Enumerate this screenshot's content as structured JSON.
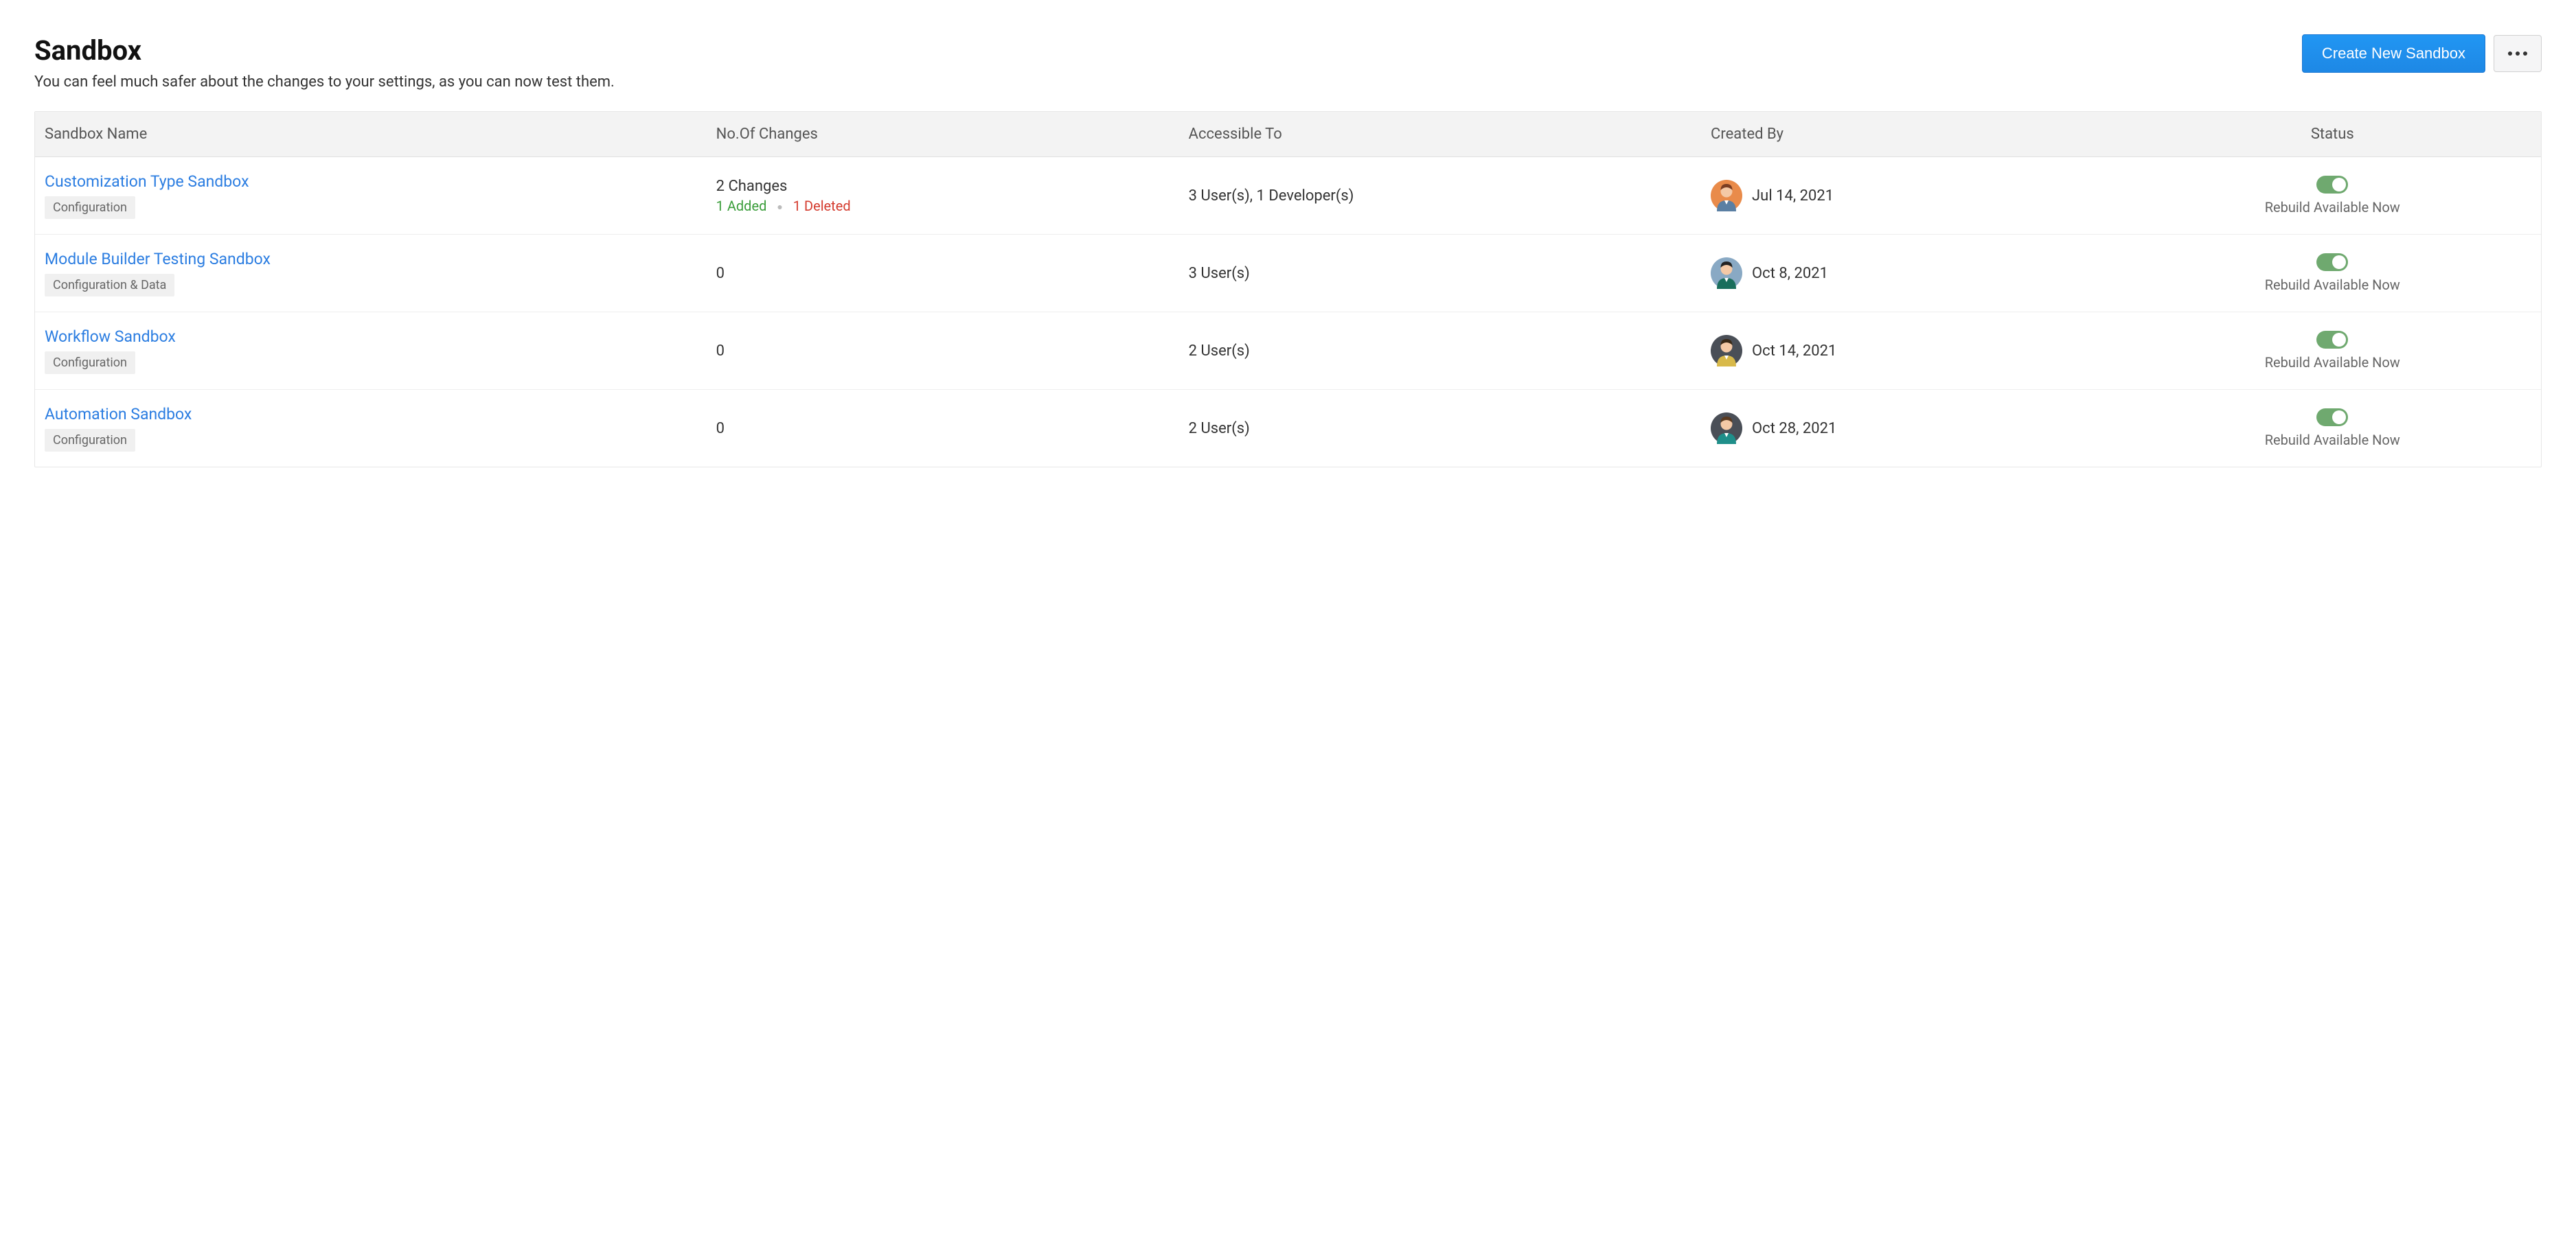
{
  "header": {
    "title": "Sandbox",
    "subtitle": "You can feel much safer about the changes to your settings, as you can now test them.",
    "create_btn": "Create New Sandbox"
  },
  "table": {
    "columns": {
      "name": "Sandbox Name",
      "changes": "No.Of Changes",
      "access": "Accessible To",
      "created": "Created By",
      "status": "Status"
    },
    "rows": [
      {
        "name": "Customization Type Sandbox",
        "tag": "Configuration",
        "changes_main": "2 Changes",
        "added": "1 Added",
        "deleted": "1 Deleted",
        "access": "3 User(s), 1 Developer(s)",
        "created_date": "Jul 14, 2021",
        "avatar": {
          "bg": "#e98b4a",
          "face": "#f4c9a6",
          "hair": "#7a3e23",
          "body": "#5a7fa3"
        },
        "status_text": "Rebuild Available Now",
        "toggle_on": true
      },
      {
        "name": "Module Builder Testing Sandbox",
        "tag": "Configuration & Data",
        "changes_main": "0",
        "added": "",
        "deleted": "",
        "access": "3 User(s)",
        "created_date": "Oct 8, 2021",
        "avatar": {
          "bg": "#89a9c4",
          "face": "#f4c9a6",
          "hair": "#222",
          "body": "#1a6e5c"
        },
        "status_text": "Rebuild Available Now",
        "toggle_on": true
      },
      {
        "name": "Workflow Sandbox",
        "tag": "Configuration",
        "changes_main": "0",
        "added": "",
        "deleted": "",
        "access": "2 User(s)",
        "created_date": "Oct 14, 2021",
        "avatar": {
          "bg": "#4a4f57",
          "face": "#f4c9a6",
          "hair": "#3a2a18",
          "body": "#d8b94a"
        },
        "status_text": "Rebuild Available Now",
        "toggle_on": true
      },
      {
        "name": "Automation Sandbox",
        "tag": "Configuration",
        "changes_main": "0",
        "added": "",
        "deleted": "",
        "access": "2 User(s)",
        "created_date": "Oct 28, 2021",
        "avatar": {
          "bg": "#4a4f57",
          "face": "#f4c9a6",
          "hair": "#5a3a20",
          "body": "#1f8f8a"
        },
        "status_text": "Rebuild Available Now",
        "toggle_on": true
      }
    ]
  }
}
